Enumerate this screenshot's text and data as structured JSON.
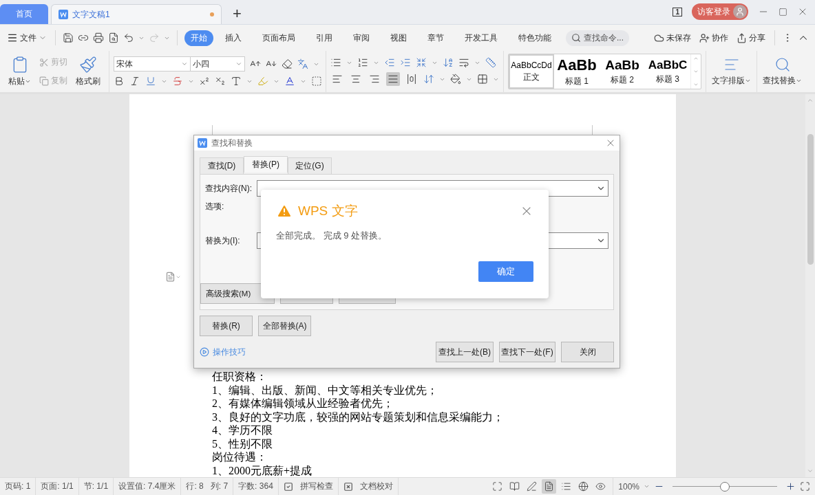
{
  "title_bar": {
    "tabs": [
      {
        "label": "首页",
        "kind": "home",
        "selected": false
      },
      {
        "label": "文字文稿1",
        "kind": "document",
        "selected": true,
        "unsaved": true
      }
    ],
    "new_tab": "+",
    "window_count": "1",
    "login": "访客登录"
  },
  "menu_bar": {
    "file": "文件",
    "tabs": [
      {
        "label": "开始",
        "selected": true
      },
      {
        "label": "插入",
        "selected": false
      },
      {
        "label": "页面布局",
        "selected": false
      },
      {
        "label": "引用",
        "selected": false
      },
      {
        "label": "审阅",
        "selected": false
      },
      {
        "label": "视图",
        "selected": false
      },
      {
        "label": "章节",
        "selected": false
      },
      {
        "label": "开发工具",
        "selected": false
      },
      {
        "label": "特色功能",
        "selected": false
      }
    ],
    "search_placeholder": "查找命令...",
    "actions": [
      "未保存",
      "协作",
      "分享"
    ]
  },
  "ribbon": {
    "paste": "粘贴",
    "cut": {
      "label": "剪切",
      "disabled": true
    },
    "copy": {
      "label": "复制",
      "disabled": true
    },
    "format_painter": "格式刷",
    "font": "宋体",
    "font_size": "小四",
    "alignment": [
      {
        "kind": "left",
        "selected": false
      },
      {
        "kind": "center",
        "selected": false
      },
      {
        "kind": "right",
        "selected": false
      },
      {
        "kind": "justify",
        "selected": true
      },
      {
        "kind": "distributed",
        "selected": false
      }
    ],
    "styles": [
      {
        "sample": "AaBbCcDd",
        "label": "正文",
        "kind": "normal",
        "selected": true
      },
      {
        "sample": "AaBb",
        "label": "标题 1",
        "kind": "heading1",
        "selected": false
      },
      {
        "sample": "AaBb",
        "label": "标题 2",
        "kind": "heading2",
        "selected": false
      },
      {
        "sample": "AaBbC",
        "label": "标题 3",
        "kind": "heading3",
        "selected": false
      }
    ],
    "text_layout": "文字排版",
    "find_replace": "查找替换"
  },
  "document": {
    "lines": [
      "任职资格：",
      "1、编辑、出版、新闻、中文等相关专业优先；",
      "2、有媒体编辑领域从业经验者优先；",
      "3、良好的文字功底，较强的网站专题策划和信息采编能力；",
      "4、学历不限",
      "5、性别不限",
      "岗位待遇：",
      "1、2000元底薪+提成"
    ]
  },
  "find_dialog": {
    "title": "查找和替换",
    "tabs": [
      {
        "label": "查找(D)",
        "selected": false
      },
      {
        "label": "替换(P)",
        "selected": true
      },
      {
        "label": "定位(G)",
        "selected": false
      }
    ],
    "find_label": "查找内容(N):",
    "options_label": "选项:",
    "replace_label": "替换为(I):",
    "advanced": "高级搜索(M)",
    "replace": "替换(R)",
    "replace_all": "全部替换(A)",
    "tips": "操作技巧",
    "find_prev": "查找上一处(B)",
    "find_next": "查找下一处(F)",
    "close": "关闭"
  },
  "alert": {
    "title": "WPS 文字",
    "message": "全部完成。 完成 9 处替换。",
    "ok": "确定"
  },
  "status_bar": {
    "items": [
      "页码: 1",
      "页面: 1/1",
      "节: 1/1",
      "设置值: 7.4厘米"
    ],
    "position": [
      "行: 8",
      "列: 7"
    ],
    "word_count": "字数: 364",
    "checks": [
      "拼写检查",
      "文档校对"
    ],
    "views": [
      {
        "kind": "fullscreen",
        "selected": false
      },
      {
        "kind": "reading",
        "selected": false
      },
      {
        "kind": "edit",
        "selected": false
      },
      {
        "kind": "page",
        "selected": true
      },
      {
        "kind": "outline",
        "selected": false
      },
      {
        "kind": "web",
        "selected": false
      },
      {
        "kind": "protect",
        "selected": false
      }
    ],
    "zoom": "100%",
    "zoom_level": {
      "level": 0.5
    }
  }
}
